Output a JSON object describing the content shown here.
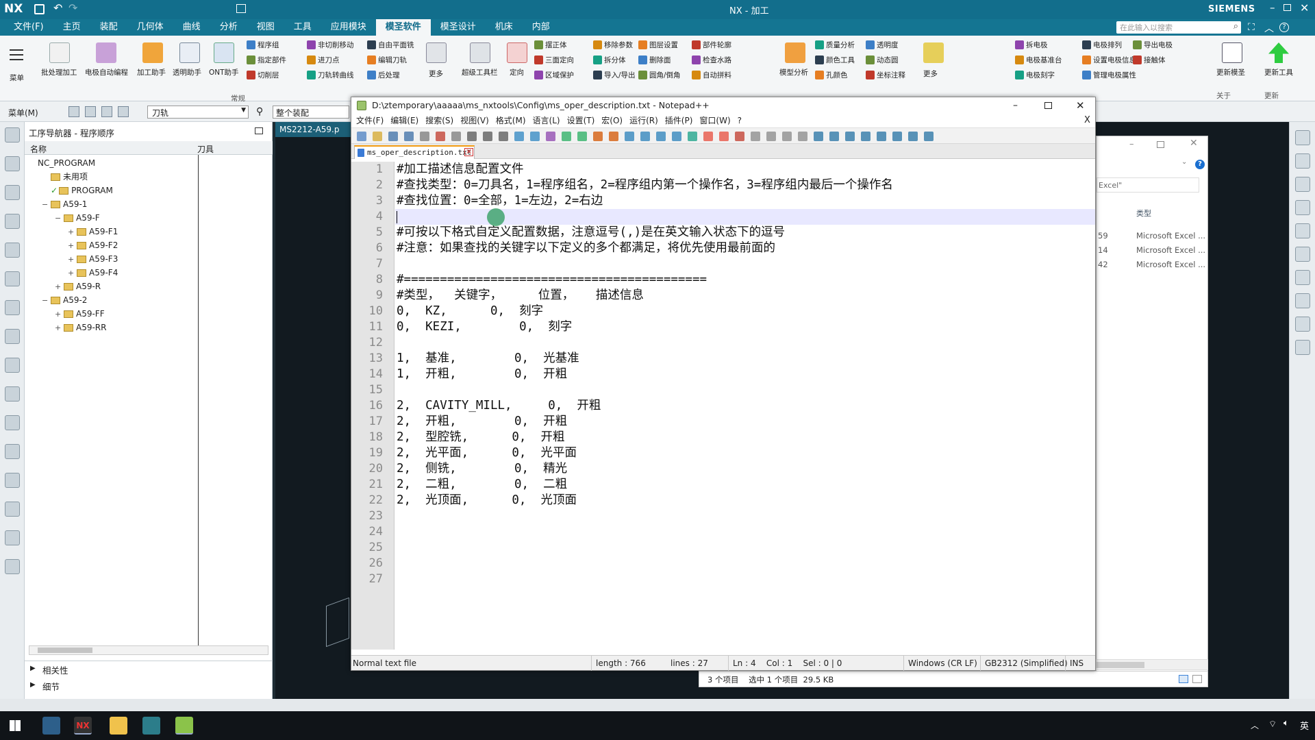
{
  "nx": {
    "logo": "NX",
    "title": "NX - 加工",
    "brand": "SIEMENS",
    "search_placeholder": "在此输入以搜索",
    "menu": [
      "文件(F)",
      "主页",
      "装配",
      "几何体",
      "曲线",
      "分析",
      "视图",
      "工具",
      "应用模块",
      "模圣软件",
      "模圣设计",
      "机床",
      "内部"
    ],
    "active_menu": "模圣软件",
    "ribbon_big": [
      "菜单",
      "批处理加工",
      "电极自动编程",
      "加工助手",
      "透明助手",
      "ONT助手",
      "更多",
      "超级工具栏",
      "定向",
      "模型分析",
      "更多",
      "更新模圣",
      "更新工具"
    ],
    "ribbon_small": [
      "程序组",
      "指定部件",
      "切削层",
      "非切削移动",
      "进刀点",
      "刀轨转曲线",
      "自由平面铣",
      "编辑刀轨",
      "后处理",
      "摆正体",
      "三面定向",
      "区域保护",
      "移除参数",
      "拆分体",
      "导入/导出",
      "图层设置",
      "删除面",
      "圆角/倒角",
      "部件轮廓",
      "检查水路",
      "自动拼料",
      "质量分析",
      "颜色工具",
      "孔颜色",
      "透明度",
      "动态圆",
      "坐标注释",
      "拆电极",
      "电极基准台",
      "电极刻字",
      "电极排列",
      "设置电极信息",
      "管理电极属性",
      "导出电极",
      "接触体"
    ],
    "ribbon_groups": [
      "常规",
      "关于",
      "更新"
    ],
    "toolbar2": {
      "menu_label": "菜单(M)",
      "filter_value": "刀轨",
      "scope_value": "整个装配"
    },
    "graphics_tab": "MS2212-A59.p"
  },
  "navigator": {
    "title": "工序导航器 - 程序顺序",
    "col_name": "名称",
    "col_tool": "刀具",
    "items": [
      {
        "label": "NC_PROGRAM",
        "level": 0,
        "expander": "",
        "folder": false
      },
      {
        "label": "未用项",
        "level": 1,
        "expander": "",
        "folder": true
      },
      {
        "label": "PROGRAM",
        "level": 1,
        "expander": "",
        "folder": true,
        "check": true
      },
      {
        "label": "A59-1",
        "level": 1,
        "expander": "−",
        "folder": true
      },
      {
        "label": "A59-F",
        "level": 2,
        "expander": "−",
        "folder": true
      },
      {
        "label": "A59-F1",
        "level": 3,
        "expander": "+",
        "folder": true
      },
      {
        "label": "A59-F2",
        "level": 3,
        "expander": "+",
        "folder": true
      },
      {
        "label": "A59-F3",
        "level": 3,
        "expander": "+",
        "folder": true
      },
      {
        "label": "A59-F4",
        "level": 3,
        "expander": "+",
        "folder": true
      },
      {
        "label": "A59-R",
        "level": 2,
        "expander": "+",
        "folder": true
      },
      {
        "label": "A59-2",
        "level": 1,
        "expander": "−",
        "folder": true
      },
      {
        "label": "A59-FF",
        "level": 2,
        "expander": "+",
        "folder": true
      },
      {
        "label": "A59-RR",
        "level": 2,
        "expander": "+",
        "folder": true
      }
    ],
    "sections": [
      "相关性",
      "细节"
    ]
  },
  "notepad": {
    "title": "D:\\ztemporary\\aaaaa\\ms_nxtools\\Config\\ms_oper_description.txt - Notepad++",
    "menu": [
      "文件(F)",
      "编辑(E)",
      "搜索(S)",
      "视图(V)",
      "格式(M)",
      "语言(L)",
      "设置(T)",
      "宏(O)",
      "运行(R)",
      "插件(P)",
      "窗口(W)",
      "?"
    ],
    "tab": "ms_oper_description.txt",
    "lines": [
      "#加工描述信息配置文件",
      "#查找类型：0=刀具名，1=程序组名，2=程序组内第一个操作名，3=程序组内最后一个操作名",
      "#查找位置：0=全部，1=左边，2=右边",
      "",
      "#可按以下格式自定义配置数据，注意逗号(,)是在英文输入状态下的逗号",
      "#注意：如果查找的关键字以下定义的多个都满足，将优先使用最前面的",
      "",
      "#==========================================",
      "#类型，  关键字，     位置，   描述信息",
      "0,  KZ,      0,  刻字",
      "0,  KEZI,        0,  刻字",
      "",
      "1,  基准,        0,  光基准",
      "1,  开粗,        0,  开粗",
      "",
      "2,  CAVITY_MILL,     0,  开粗",
      "2,  开粗,        0,  开粗",
      "2,  型腔铣,      0,  开粗",
      "2,  光平面,      0,  光平面",
      "2,  侧铣,        0,  精光",
      "2,  二粗,        0,  二粗",
      "2,  光顶面,      0,  光顶面",
      "",
      "",
      "",
      "",
      ""
    ],
    "status": {
      "type": "Normal text file",
      "length": "length : 766",
      "lines": "lines : 27",
      "pos": "Ln : 4    Col : 1    Sel : 0 | 0",
      "eol": "Windows (CR LF)",
      "encoding": "GB2312 (Simplified)",
      "mode": "INS"
    }
  },
  "explorer": {
    "search_placeholder": "Excel\"",
    "col_type": "类型",
    "rows": [
      {
        "num": "59",
        "type": "Microsoft Excel ..."
      },
      {
        "num": "14",
        "type": "Microsoft Excel ..."
      },
      {
        "num": "42",
        "type": "Microsoft Excel ..."
      }
    ],
    "status": "3 个项目    选中 1 个项目  29.5 KB"
  },
  "taskbar": {
    "lang": "英"
  },
  "colors": {
    "nx_bar": "#126e8c",
    "accent": "#f2c94c",
    "gutter": "#e4e4e4"
  }
}
